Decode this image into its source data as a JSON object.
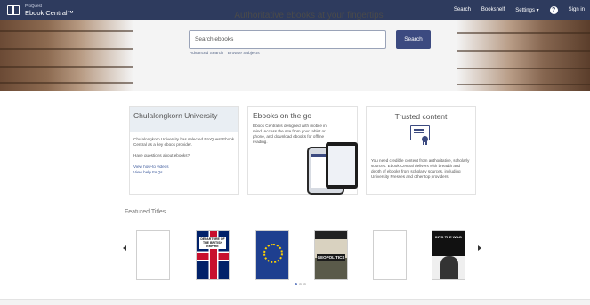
{
  "nav": {
    "brand": "ProQuest",
    "product": "Ebook Central™",
    "links": [
      "Search",
      "Bookshelf",
      "Settings ▾",
      "Sign in"
    ],
    "help_icon": "help-icon"
  },
  "hero": {
    "title": "Authoritative ebooks at your fingertips",
    "search_placeholder": "Search ebooks",
    "search_button": "Search",
    "links": [
      "Advanced Search",
      "Browse Subjects"
    ]
  },
  "cards": {
    "university": {
      "title": "Chulalongkorn University",
      "body": "Chulalongkorn University has selected ProQuest Ebook Central as a key ebook provider.",
      "question": "Have questions about ebooks?",
      "links": [
        "View how-to videos",
        "View help FAQs"
      ]
    },
    "go": {
      "title": "Ebooks on the go",
      "body": "Ebook Central is designed with mobile in mind. Access the site from your tablet or phone, and download ebooks for offline reading."
    },
    "trusted": {
      "title": "Trusted content",
      "icon": "certificate-icon",
      "body": "You need credible content from authoritative, scholarly sources. Ebook Central delivers with breadth and depth of ebooks from scholarly sources, including University Presses and other top providers."
    }
  },
  "featured": {
    "title": "Featured Titles",
    "books": [
      {
        "title": ""
      },
      {
        "title": "DEPARTURE OF THE BRITISH EMPIRE"
      },
      {
        "title": ""
      },
      {
        "title": "GEOPOLITICS"
      },
      {
        "title": ""
      },
      {
        "title": "INTO THE WILD"
      }
    ],
    "pages": 3,
    "active_page": 1
  },
  "colors": {
    "nav_bg": "#2e3b5e",
    "accent": "#3c4a80",
    "link": "#3d5a9c"
  }
}
